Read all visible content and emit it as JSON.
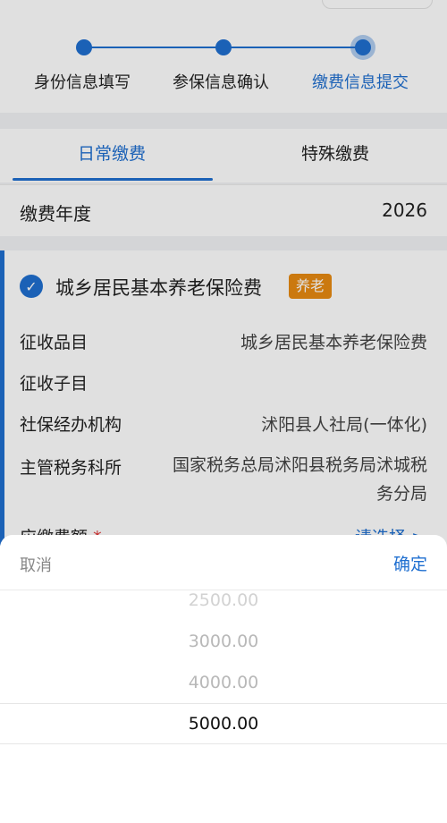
{
  "steps": {
    "items": [
      {
        "label": "身份信息填写"
      },
      {
        "label": "参保信息确认"
      },
      {
        "label": "缴费信息提交"
      }
    ]
  },
  "tabs": [
    {
      "label": "日常缴费"
    },
    {
      "label": "特殊缴费"
    }
  ],
  "year": {
    "label": "缴费年度",
    "value": "2026"
  },
  "card": {
    "title": "城乡居民基本养老保险费",
    "badge": "养老",
    "rows": [
      {
        "label": "征收品目",
        "value": "城乡居民基本养老保险费"
      },
      {
        "label": "征收子目",
        "value": ""
      },
      {
        "label": "社保经办机构",
        "value": "沭阳县人社局(一体化)"
      },
      {
        "label": "主管税务科所",
        "value": "国家税务总局沭阳县税务局沭城税务分局"
      }
    ],
    "amount_label": "应缴费额",
    "required_mark": "*",
    "select_link": "请选择 >"
  },
  "picker": {
    "cancel": "取消",
    "confirm": "确定",
    "options": [
      "2500.00",
      "3000.00",
      "4000.00",
      "5000.00"
    ],
    "selected": "5000.00"
  },
  "colors": {
    "accent": "#1f6fd0",
    "badge": "#e88a12",
    "required": "#e03b3b"
  }
}
